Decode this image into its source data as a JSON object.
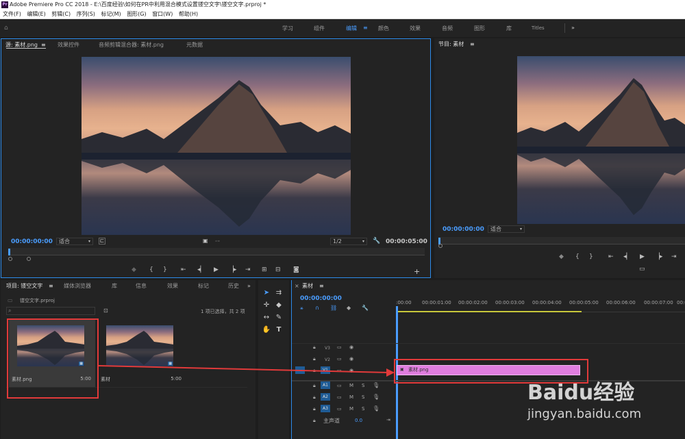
{
  "title": "Adobe Premiere Pro CC 2018 - E:\\百度经验\\如何在PR中利用混合模式设置镂空文字\\镂空文字.prproj *",
  "logo_text": "Pr",
  "menu": [
    "文件(F)",
    "编辑(E)",
    "剪辑(C)",
    "序列(S)",
    "标记(M)",
    "图形(G)",
    "窗口(W)",
    "帮助(H)"
  ],
  "workspace_tabs": [
    "学习",
    "组件",
    "编辑",
    "颜色",
    "效果",
    "音频",
    "图形",
    "库",
    "Titles"
  ],
  "workspace_active": "编辑",
  "source_panel": {
    "tabs": [
      "源: 素材.png",
      "效果控件",
      "音频剪辑混合器: 素材.png",
      "元数据"
    ],
    "timecode_left": "00:00:00:00",
    "fit": "适合",
    "resolution": "1/2",
    "timecode_right": "00:00:05:00"
  },
  "program_panel": {
    "tab": "节目: 素材",
    "timecode": "00:00:00:00",
    "fit": "适合"
  },
  "project_panel": {
    "tabs": [
      "项目: 镂空文字",
      "媒体浏览器",
      "库",
      "信息",
      "效果",
      "标记",
      "历史"
    ],
    "file": "镂空文字.prproj",
    "selection_info": "1 项已选择，共 2 项",
    "items": [
      {
        "name": "素材.png",
        "duration": "5:00"
      },
      {
        "name": "素材",
        "duration": "5:00"
      }
    ]
  },
  "timeline_panel": {
    "tab": "素材",
    "timecode": "00:00:00:00",
    "ruler": [
      ":00:00",
      "00:00:01:00",
      "00:00:02:00",
      "00:00:03:00",
      "00:00:04:00",
      "00:00:05:00",
      "00:00:06:00",
      "00:00:07:00",
      "00:00"
    ],
    "video_tracks": [
      "V3",
      "V2",
      "V1"
    ],
    "audio_tracks": [
      "A1",
      "A2",
      "A3"
    ],
    "master": "主声道",
    "master_value": "0.0",
    "clip_label": "素材.png",
    "clip_color": "#e07ddf"
  },
  "watermark": {
    "brand": "Baidu经验",
    "url": "jingyan.baidu.com"
  },
  "colors": {
    "accent": "#2d8ceb",
    "highlight": "#e23a3a",
    "timecode": "#4a9dff"
  }
}
